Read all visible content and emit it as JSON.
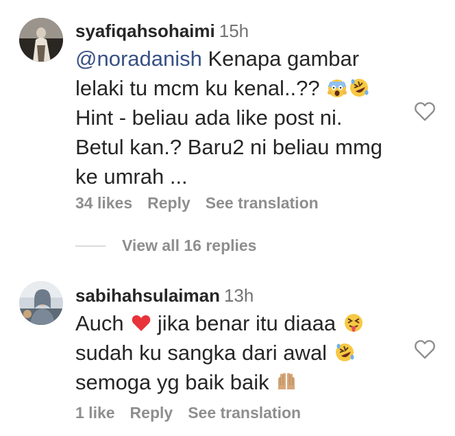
{
  "comments": [
    {
      "username": "syafiqahsohaimi",
      "time": "15h",
      "mention": "@noradanish",
      "lines": [
        "Kenapa gambar",
        "lelaki tu mcm ku kenal..??",
        "Hint - beliau ada like post ni.",
        "Betul kan.? Baru2 ni beliau mmg",
        "ke umrah ..."
      ],
      "likes": "34 likes",
      "reply": "Reply",
      "translate": "See translation",
      "view_replies": "View all 16 replies"
    },
    {
      "username": "sabihahsulaiman",
      "time": "13h",
      "lines": [
        "Auch",
        "jika benar itu diaaa",
        "sudah ku sangka dari awal",
        "semoga yg baik baik"
      ],
      "likes": "1 like",
      "reply": "Reply",
      "translate": "See translation"
    }
  ],
  "icons": {
    "like": "heart-outline-icon",
    "emoji_scream": "face-screaming-in-fear-icon",
    "emoji_rofl": "rolling-on-the-floor-laughing-icon",
    "emoji_heart": "red-heart-icon",
    "emoji_tongue": "squinting-face-with-tongue-icon",
    "emoji_palms": "palms-up-together-icon"
  },
  "colors": {
    "mention": "#385185",
    "text": "#262626",
    "secondary": "#8e8e8e",
    "divider": "#dbdbdb"
  }
}
